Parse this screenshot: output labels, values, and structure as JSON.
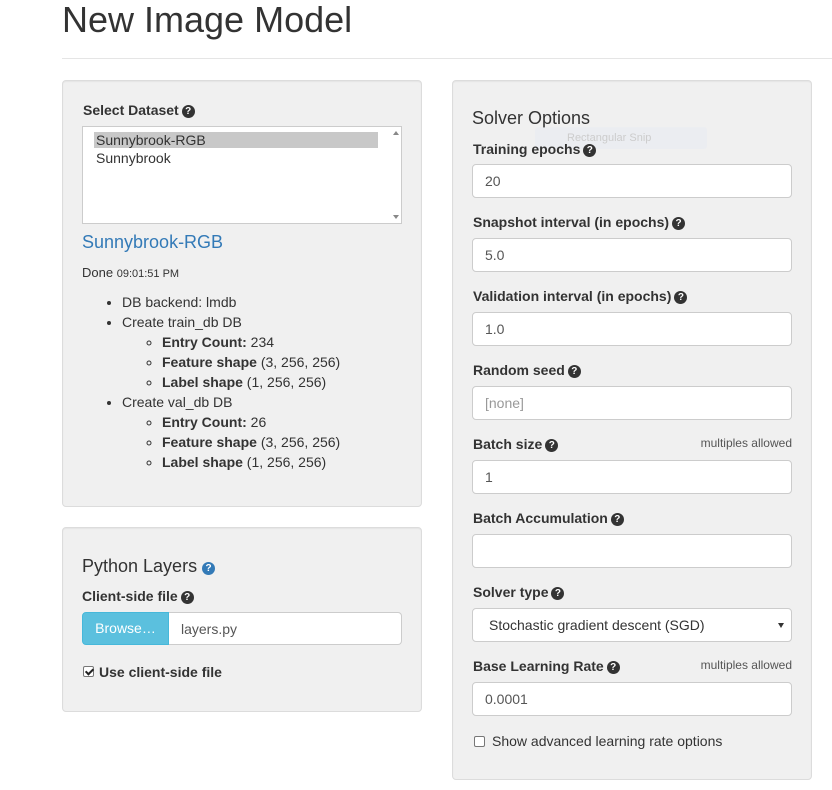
{
  "page": {
    "title": "New Image Model"
  },
  "dataset": {
    "label": "Select Dataset",
    "options": [
      {
        "name": "Sunnybrook-RGB"
      },
      {
        "name": "Sunnybrook"
      }
    ],
    "selected_link": "Sunnybrook-RGB",
    "status": "Done",
    "status_time": "09:01:51 PM",
    "details": {
      "backend": "DB backend: lmdb",
      "train_title": "Create train_db DB",
      "train": {
        "entry_count_label": "Entry Count:",
        "entry_count": " 234",
        "feature_label": "Feature shape",
        "feature_value": " (3, 256, 256)",
        "label_label": "Label shape",
        "label_value": " (1, 256, 256)"
      },
      "val_title": "Create val_db DB",
      "val": {
        "entry_count_label": "Entry Count:",
        "entry_count": " 26",
        "feature_label": "Feature shape",
        "feature_value": " (3, 256, 256)",
        "label_label": "Label shape",
        "label_value": " (1, 256, 256)"
      }
    }
  },
  "python_layers": {
    "title": "Python Layers",
    "client_file_label": "Client-side file",
    "browse_label": "Browse…",
    "file_name": "layers.py",
    "use_client_label": "Use client-side file",
    "use_client_checked": true
  },
  "solver": {
    "title": "Solver Options",
    "ghost_text": "Rectangular Snip",
    "training_epochs": {
      "label": "Training epochs",
      "value": "20"
    },
    "snapshot_interval": {
      "label": "Snapshot interval (in epochs)",
      "value": "5.0"
    },
    "validation_interval": {
      "label": "Validation interval (in epochs)",
      "value": "1.0"
    },
    "random_seed": {
      "label": "Random seed",
      "placeholder": "[none]"
    },
    "batch_size": {
      "label": "Batch size",
      "note": "multiples allowed",
      "value": "1"
    },
    "batch_accumulation": {
      "label": "Batch Accumulation",
      "value": ""
    },
    "solver_type": {
      "label": "Solver type",
      "value": "Stochastic gradient descent (SGD)"
    },
    "base_lr": {
      "label": "Base Learning Rate",
      "note": "multiples allowed",
      "value": "0.0001"
    },
    "advanced_lr_label": "Show advanced learning rate options",
    "advanced_lr_checked": false
  },
  "icons": {
    "help": "question-circle-icon",
    "check": "check-icon",
    "caret": "caret-down-icon"
  }
}
